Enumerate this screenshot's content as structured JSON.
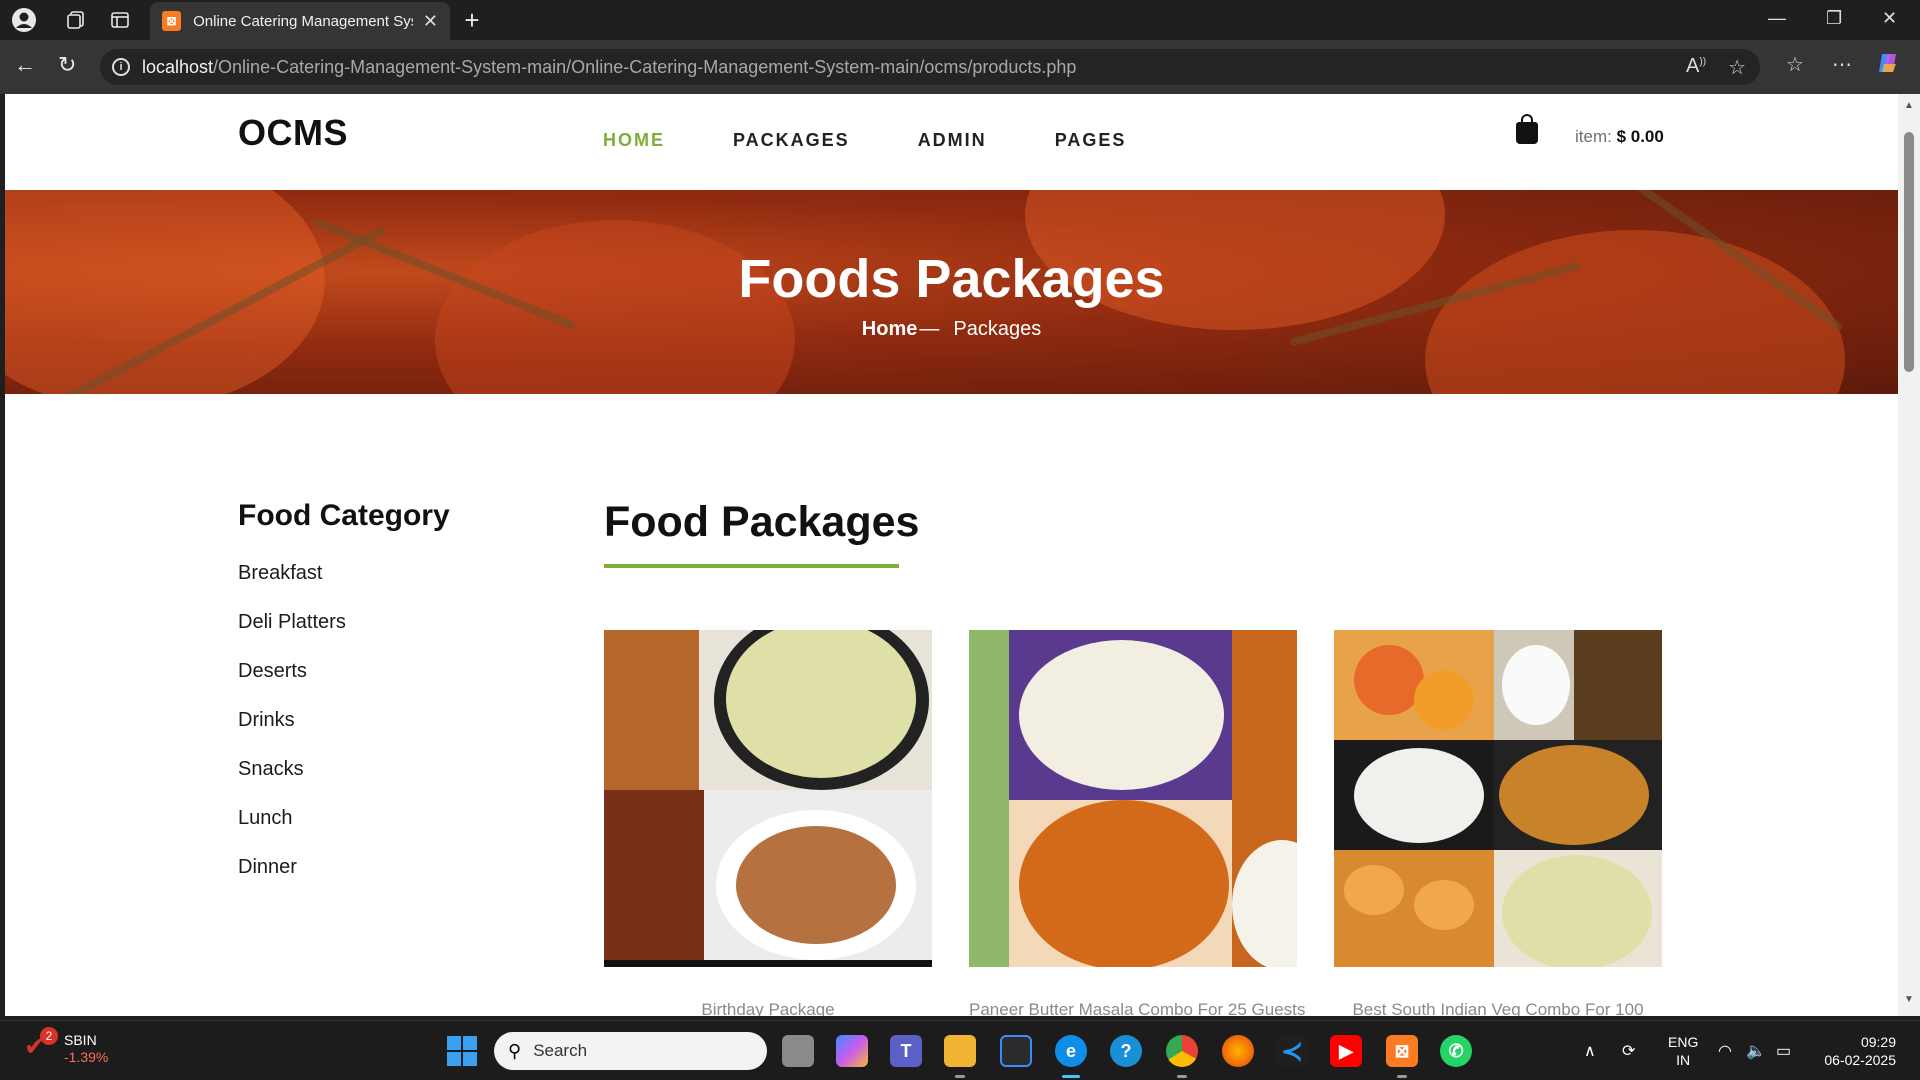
{
  "browser": {
    "tab_title": "Online Catering Management Sys",
    "url_host": "localhost",
    "url_path": "/Online-Catering-Management-System-main/Online-Catering-Management-System-main/ocms/products.php"
  },
  "site": {
    "logo": "OCMS",
    "nav": [
      {
        "label": "HOME",
        "active": true
      },
      {
        "label": "PACKAGES",
        "active": false
      },
      {
        "label": "ADMIN",
        "active": false
      },
      {
        "label": "PAGES",
        "active": false
      }
    ],
    "cart": {
      "label": "item:",
      "amount": "$ 0.00"
    },
    "accent_color": "#7fad39"
  },
  "hero": {
    "title": "Foods Packages",
    "crumb_home": "Home",
    "crumb_sep": "—",
    "crumb_current": "Packages"
  },
  "sidebar": {
    "title": "Food Category",
    "items": [
      "Breakfast",
      "Deli Platters",
      "Deserts",
      "Drinks",
      "Snacks",
      "Lunch",
      "Dinner"
    ]
  },
  "main": {
    "title": "Food Packages",
    "packages": [
      {
        "name": "Birthday Package"
      },
      {
        "name": "Paneer Butter Masala Combo For 25 Guests"
      },
      {
        "name": "Best South Indian Veg Combo For 100"
      }
    ]
  },
  "taskbar": {
    "stock_badge": "2",
    "stock_name": "SBIN",
    "stock_change": "-1.39%",
    "search_placeholder": "Search",
    "lang_top": "ENG",
    "lang_bottom": "IN",
    "time": "09:29",
    "date": "06-02-2025"
  }
}
